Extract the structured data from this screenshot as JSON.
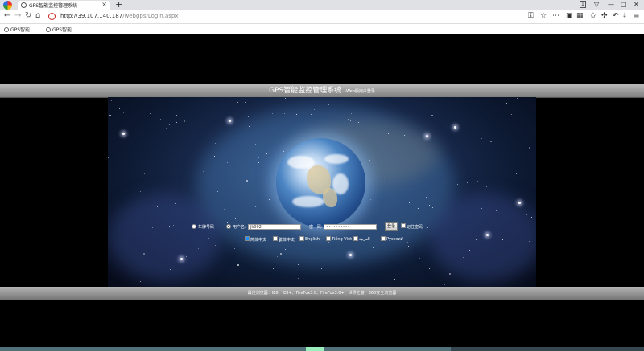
{
  "browser": {
    "tab_title": "GPS智能监控管理系统",
    "new_tab": "+",
    "url_host": "http://39.107.140.187",
    "url_path": "/webgps/Login.aspx",
    "bookmarks": [
      "GPS智能",
      "GPS智能"
    ],
    "window_controls": [
      "1",
      "▽",
      "—",
      "□",
      "✕"
    ],
    "toolbar_icons": [
      "key-icon",
      "star-icon",
      "more-icon",
      "sidebar-icon",
      "grid-icon",
      "favorites-icon",
      "extensions-icon",
      "undo-icon",
      "download-icon",
      "menu-icon"
    ]
  },
  "header": {
    "title": "GPS智能监控管理系统",
    "subtitle": "-Web版用户登录"
  },
  "login": {
    "radio_car": "车牌号码",
    "radio_user": "用户名:",
    "username_value": "jk002",
    "password_label": "密　码:",
    "password_value": "••••••••••",
    "login_button": "登录",
    "remember_label": "记住密码",
    "languages": [
      {
        "label": "简体中文",
        "checked": true
      },
      {
        "label": "繁体中文",
        "checked": false
      },
      {
        "label": "English",
        "checked": false
      },
      {
        "label": "Tiếng Việt",
        "checked": false
      },
      {
        "label": "العربية",
        "checked": false
      },
      {
        "label": "Русский",
        "checked": false
      }
    ]
  },
  "footer": {
    "text": "最佳浏览器：IE8、IE8+、FireFox3.0、FireFox3.0+、世界之窗、360安全浏览器"
  },
  "colors": {
    "header_top": "#b9b9b9",
    "header_bottom": "#7e7e7e",
    "page_bg": "#000000",
    "checked": "#1e90ff"
  }
}
